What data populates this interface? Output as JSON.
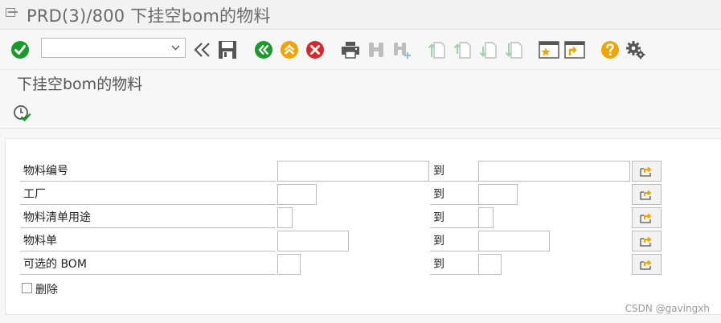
{
  "window": {
    "title": "PRD(3)/800 下挂空bom的物料"
  },
  "toolbar": {
    "command_field_value": "",
    "buttons": [
      {
        "name": "enter-icon",
        "color": "#1a9a2a"
      },
      {
        "name": "double-left-arrows-icon"
      },
      {
        "name": "save-icon"
      },
      {
        "name": "back-icon",
        "color": "#1a9a2a"
      },
      {
        "name": "exit-icon",
        "color": "#f0a400"
      },
      {
        "name": "cancel-icon",
        "color": "#d9262a"
      },
      {
        "name": "print-icon"
      },
      {
        "name": "find-icon"
      },
      {
        "name": "find-next-icon"
      },
      {
        "name": "first-page-icon"
      },
      {
        "name": "previous-page-icon"
      },
      {
        "name": "next-page-icon"
      },
      {
        "name": "last-page-icon"
      },
      {
        "name": "create-session-icon"
      },
      {
        "name": "shortcut-icon"
      },
      {
        "name": "help-icon",
        "color": "#f0a400"
      },
      {
        "name": "settings-gear-icon"
      }
    ]
  },
  "screen": {
    "title": "下挂空bom的物料"
  },
  "app_toolbar": {
    "execute_icon": "execute-clock-check-icon"
  },
  "selection": {
    "to_label": "到",
    "rows": [
      {
        "label": "物料编号",
        "from": "",
        "to": ""
      },
      {
        "label": "工厂",
        "from": "",
        "to": ""
      },
      {
        "label": "物料清单用途",
        "from": "",
        "to": ""
      },
      {
        "label": "物料单",
        "from": "",
        "to": ""
      },
      {
        "label": "可选的 BOM",
        "from": "",
        "to": ""
      }
    ],
    "checkbox": {
      "label": "删除",
      "checked": false
    }
  },
  "watermark": "CSDN @gavingxh"
}
